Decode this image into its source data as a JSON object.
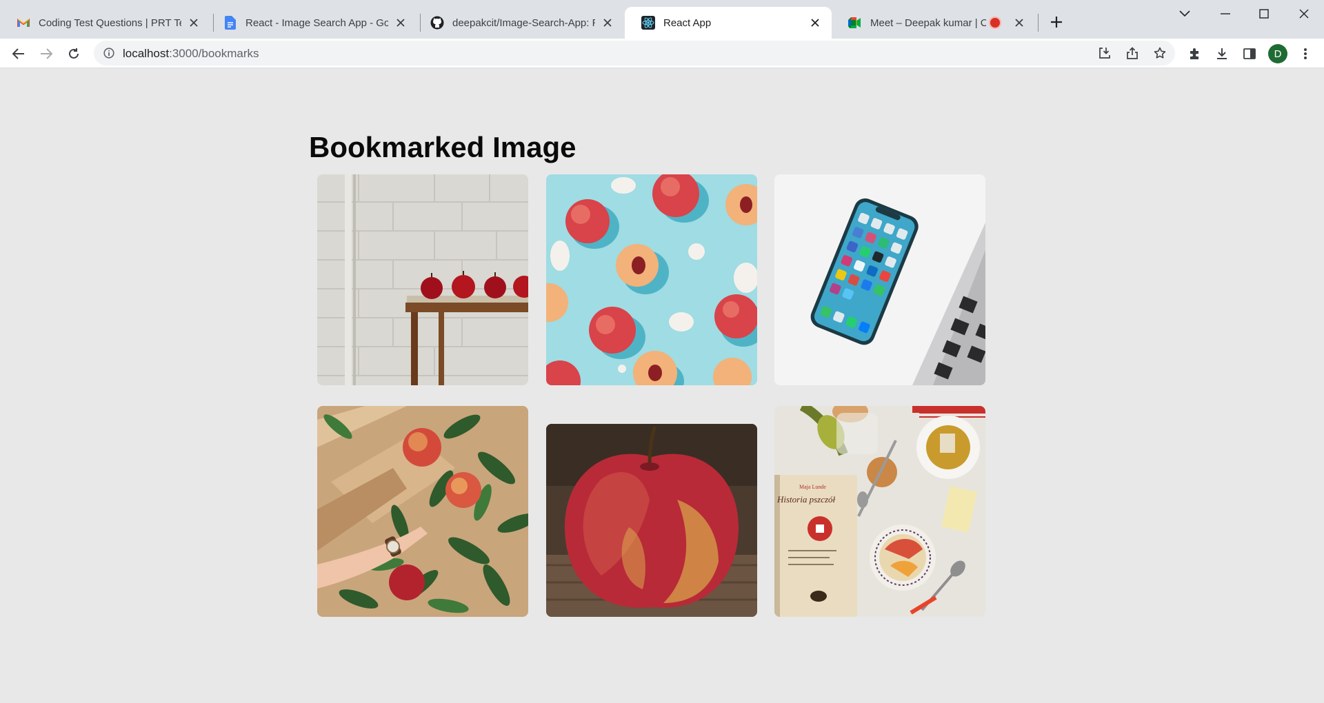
{
  "tabs": [
    {
      "title": "Coding Test Questions | PRT Test",
      "favicon": "gmail-icon"
    },
    {
      "title": "React - Image Search App - Goog",
      "favicon": "google-docs-icon"
    },
    {
      "title": "deepakcit/Image-Search-App: Re",
      "favicon": "github-icon"
    },
    {
      "title": "React App",
      "favicon": "react-icon",
      "active": true
    },
    {
      "title": "Meet – Deepak kumar | Codi",
      "favicon": "google-meet-icon",
      "recording": true
    }
  ],
  "address_bar": {
    "host": "localhost",
    "path": ":3000/bookmarks"
  },
  "profile": {
    "initial": "D",
    "color": "#1e6b33"
  },
  "page": {
    "heading": "Bookmarked Image",
    "images": [
      {
        "subject": "red apples on a wooden table by a white wall"
      },
      {
        "subject": "halved peaches on a light blue background"
      },
      {
        "subject": "smartphone beside a laptop keyboard"
      },
      {
        "subject": "hand picking apples among green leaves"
      },
      {
        "subject": "single red apple on wooden surface"
      },
      {
        "subject": "breakfast with pears, tea, book and fruit bowl"
      }
    ],
    "book_cover_text": {
      "author": "Maja Lunde",
      "title": "Historia pszczół"
    }
  }
}
